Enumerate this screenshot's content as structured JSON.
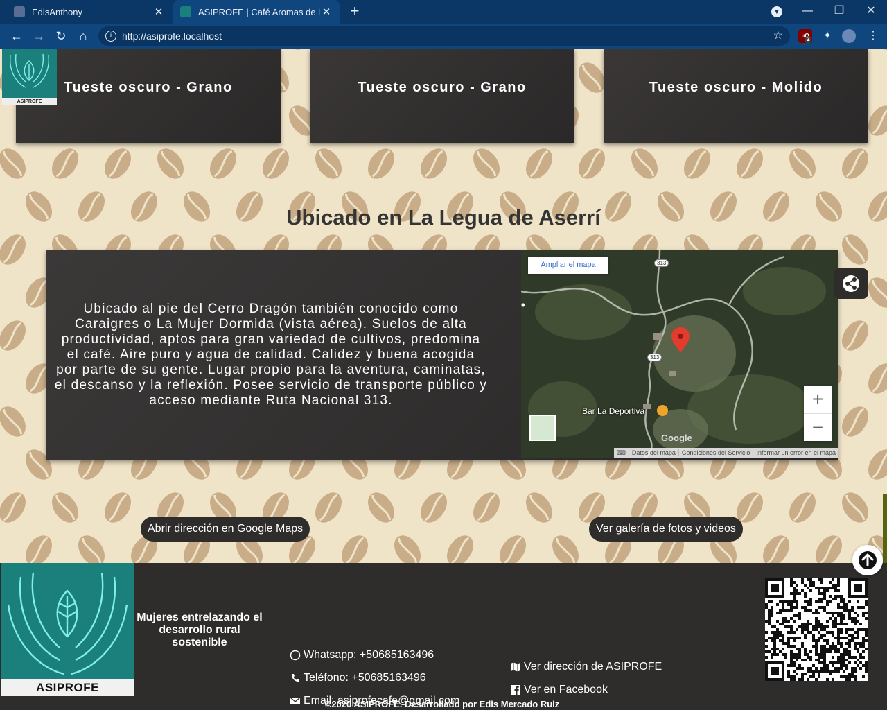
{
  "browser": {
    "tabs": [
      {
        "title": "EdisAnthony",
        "active": false
      },
      {
        "title": "ASIPROFE | Café Aromas de la Legua",
        "active": true
      }
    ],
    "url": "http://asiprofe.localhost",
    "extension_badge": "2"
  },
  "products": [
    {
      "name": "Tueste oscuro - Grano"
    },
    {
      "name": "Tueste oscuro - Grano"
    },
    {
      "name": "Tueste oscuro - Molido"
    }
  ],
  "logo": {
    "label": "ASIPROFE"
  },
  "location": {
    "title": "Ubicado en La Legua de Aserrí",
    "description": "Ubicado al pie del Cerro Dragón también conocido como Caraigres o La Mujer Dormida (vista aérea). Suelos de alta productividad, aptos para gran variedad de cultivos, predomina el café. Aire puro y agua de calidad. Calidez y buena acogida por parte de su gente. Lugar propio para la aventura, caminatas, el descanso y la reflexión. Posee servicio de transporte público y acceso mediante Ruta Nacional 313."
  },
  "map": {
    "enlarge_label": "Ampliar el mapa",
    "place_label": "Bar La Deportiva",
    "route_number": "313",
    "footer": [
      "Datos del mapa",
      "Condiciones del Servicio",
      "Informar un error en el mapa"
    ]
  },
  "actions": {
    "open_maps": "Abrir dirección en Google Maps",
    "gallery": "Ver galería de fotos y videos"
  },
  "footer": {
    "tagline": "Mujeres entrelazando el desarrollo rural sostenible",
    "whatsapp": "Whatsapp: +50685163496",
    "phone": "Teléfono: +50685163496",
    "email": "Email: asiprofecafe@gmail.com",
    "address_link": "Ver dirección de ASIPROFE",
    "facebook_link": "Ver en Facebook",
    "copyright": "©2020 ASIPROFE. Desarrollado por Edis Mercado Ruiz"
  },
  "colors": {
    "chrome_dark": "#0b3766",
    "chrome": "#10467e",
    "page_bg": "#efe3c8",
    "bean": "#c9ad89",
    "panel": "#2f2d2c",
    "logo_teal": "#1b7f7c",
    "pin": "#e33b2e"
  }
}
